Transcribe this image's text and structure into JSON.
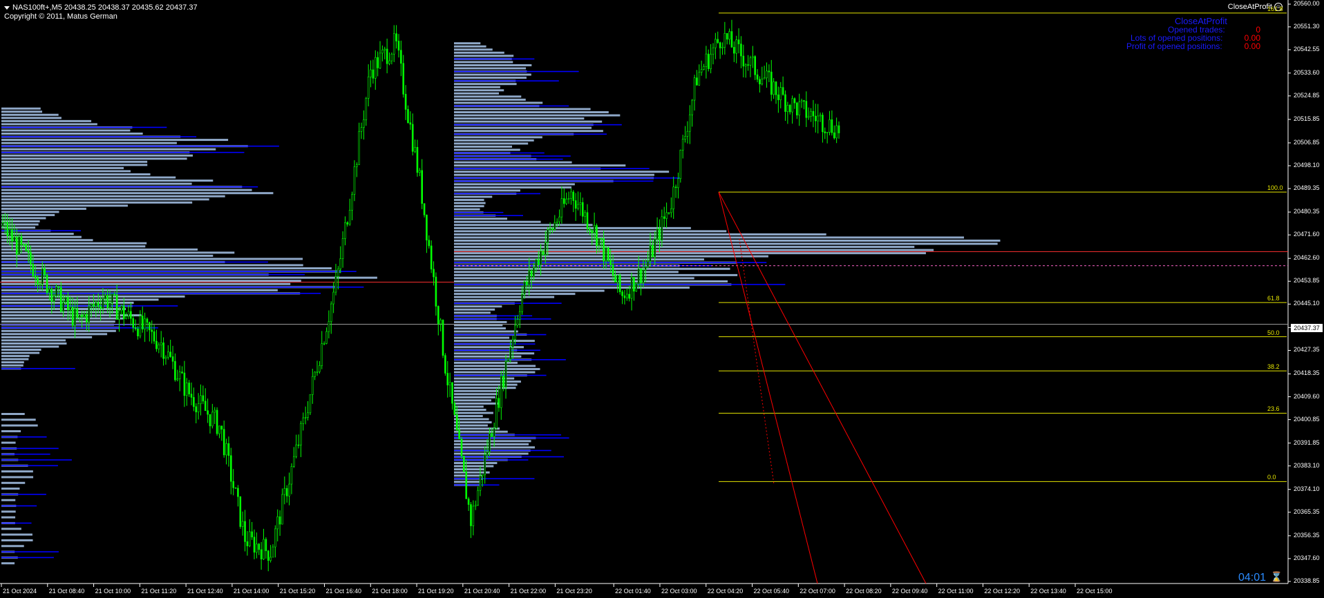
{
  "header": {
    "title": "NAS100ft+,M5  20438.25 20438.37 20435.62 20437.37",
    "copyright": "Copyright © 2011, Matus German"
  },
  "expert": {
    "name": "CloseAtProfit",
    "icon": "smiley-icon"
  },
  "info_panel": {
    "title": "CloseAtProfit",
    "rows": [
      {
        "label": "Opened trades:",
        "value": "0"
      },
      {
        "label": "Lots of opened positions:",
        "value": "0.00"
      },
      {
        "label": "Profit of opened positions:",
        "value": "0.00"
      }
    ]
  },
  "timer": "04:01",
  "current_price": "20437.37",
  "colors": {
    "background": "#000000",
    "candle": "#00ff00",
    "profile": "#8fa8c8",
    "profile_line": "#0000ff",
    "fib": "#e6e600",
    "trend": "#ff0000",
    "info_text": "#1a1aff",
    "info_value": "#ff0000"
  },
  "price_axis": [
    "20560.00",
    "20551.30",
    "20542.55",
    "20533.60",
    "20524.85",
    "20515.85",
    "20506.85",
    "20498.10",
    "20489.35",
    "20480.35",
    "20471.60",
    "20462.60",
    "20453.85",
    "20445.10",
    "20436.10",
    "20427.35",
    "20418.35",
    "20409.60",
    "20400.85",
    "20391.85",
    "20383.10",
    "20374.10",
    "20365.35",
    "20356.35",
    "20347.60",
    "20338.85"
  ],
  "time_axis": [
    "21 Oct 2024",
    "21 Oct 08:40",
    "21 Oct 10:00",
    "21 Oct 11:20",
    "21 Oct 12:40",
    "21 Oct 14:00",
    "21 Oct 15:20",
    "21 Oct 16:40",
    "21 Oct 18:00",
    "21 Oct 19:20",
    "21 Oct 20:40",
    "21 Oct 22:00",
    "21 Oct 23:20",
    "22 Oct 01:40",
    "22 Oct 03:00",
    "22 Oct 04:20",
    "22 Oct 05:40",
    "22 Oct 07:00",
    "22 Oct 08:20",
    "22 Oct 09:40",
    "22 Oct 11:00",
    "22 Oct 12:20",
    "22 Oct 13:40",
    "22 Oct 15:00"
  ],
  "fib_levels": [
    {
      "label": "161.8",
      "price": 20556.6
    },
    {
      "label": "100.0",
      "price": 20488.0
    },
    {
      "label": "61.8",
      "price": 20445.7
    },
    {
      "label": "50.0",
      "price": 20432.6
    },
    {
      "label": "38.2",
      "price": 20419.5
    },
    {
      "label": "23.6",
      "price": 20403.3
    },
    {
      "label": "0.0",
      "price": 20377.1
    }
  ],
  "chart_data": {
    "type": "candlestick",
    "symbol": "NAS100ft+",
    "timeframe": "M5",
    "ylim": [
      20338.85,
      20560.0
    ],
    "close_path": [
      [
        0,
        20475
      ],
      [
        0.03,
        20462
      ],
      [
        0.06,
        20450
      ],
      [
        0.09,
        20438
      ],
      [
        0.12,
        20448
      ],
      [
        0.15,
        20440
      ],
      [
        0.19,
        20430
      ],
      [
        0.22,
        20412
      ],
      [
        0.26,
        20398
      ],
      [
        0.29,
        20355
      ],
      [
        0.32,
        20350
      ],
      [
        0.36,
        20400
      ],
      [
        0.4,
        20455
      ],
      [
        0.44,
        20535
      ],
      [
        0.47,
        20545
      ],
      [
        0.5,
        20490
      ],
      [
        0.53,
        20420
      ],
      [
        0.56,
        20362
      ],
      [
        0.59,
        20405
      ],
      [
        0.62,
        20448
      ],
      [
        0.65,
        20470
      ],
      [
        0.68,
        20488
      ],
      [
        0.71,
        20472
      ],
      [
        0.74,
        20448
      ],
      [
        0.77,
        20460
      ],
      [
        0.8,
        20485
      ],
      [
        0.83,
        20532
      ],
      [
        0.86,
        20548
      ],
      [
        0.9,
        20535
      ],
      [
        0.94,
        20522
      ],
      [
        1.0,
        20512
      ]
    ]
  }
}
